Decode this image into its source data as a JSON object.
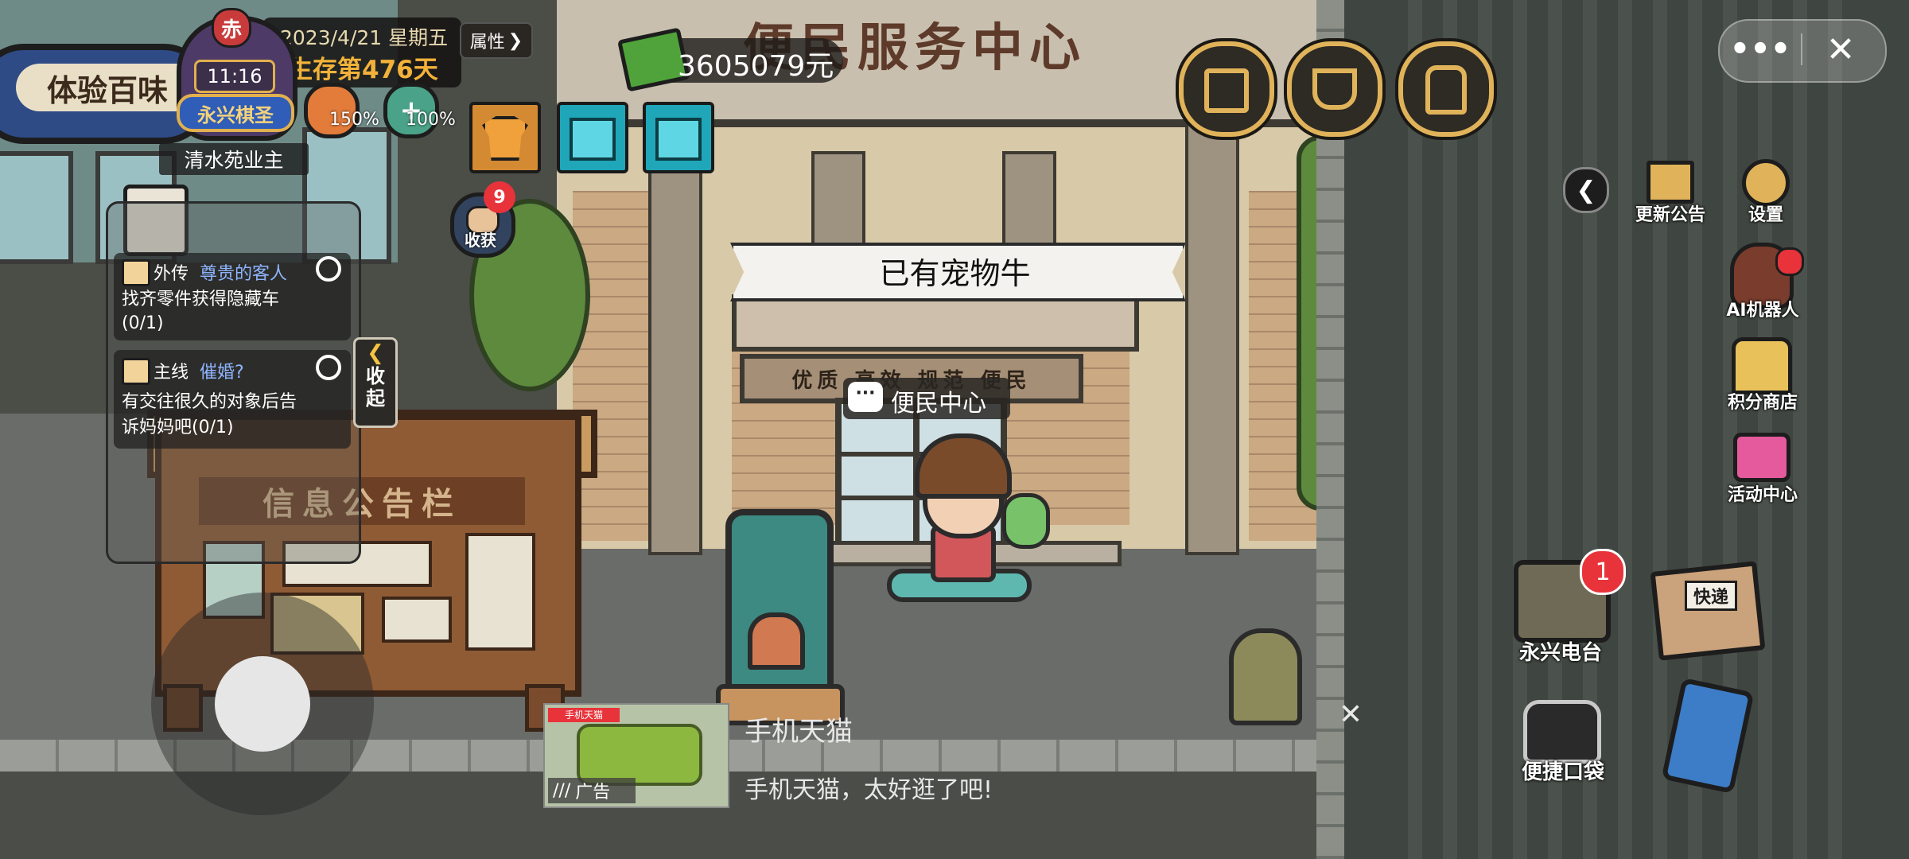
{
  "hud": {
    "date": "2023/4/21 星期五",
    "survival_days": "生存第476天",
    "clock": "11:16",
    "level_badge": "赤",
    "title_badge": "永兴棋圣",
    "attributes_button": "属性",
    "role_title": "清水苑业主",
    "stat_hunger": "150%",
    "stat_health": "100%",
    "money": "3605079元",
    "harvest_label": "收获",
    "harvest_badge": "9"
  },
  "location": {
    "shop_name_left": "体验百味",
    "building_sign": "便民服务中心",
    "building_subsign": "优质 高效 规范 便民",
    "pet_banner": "已有宠物牛",
    "hint_bubble": "便民中心",
    "board_title": "信息公告栏"
  },
  "quests": [
    {
      "tag": "外传",
      "name": "尊贵的客人",
      "desc": "找齐零件获得隐藏车(0/1)"
    },
    {
      "tag": "主线",
      "name": "催婚?",
      "desc": "有交往很久的对象后告诉妈妈吧(0/1)"
    }
  ],
  "collapse_label": "收起",
  "right_menu": {
    "update_notice": "更新公告",
    "settings": "设置",
    "ai_robot": "AI机器人",
    "points_shop": "积分商店",
    "activity_center": "活动中心",
    "tv_station": "永兴电台",
    "tv_badge": "1",
    "express_label": "快递",
    "pocket": "便捷口袋"
  },
  "ad": {
    "brand": "手机天猫",
    "title": "手机天猫",
    "text": "手机天猫，太好逛了吧!",
    "ad_label": "广告"
  },
  "colors": {
    "gold": "#e0b35a",
    "quest_name": "#8fb4ff",
    "badge_red": "#e8333b"
  }
}
